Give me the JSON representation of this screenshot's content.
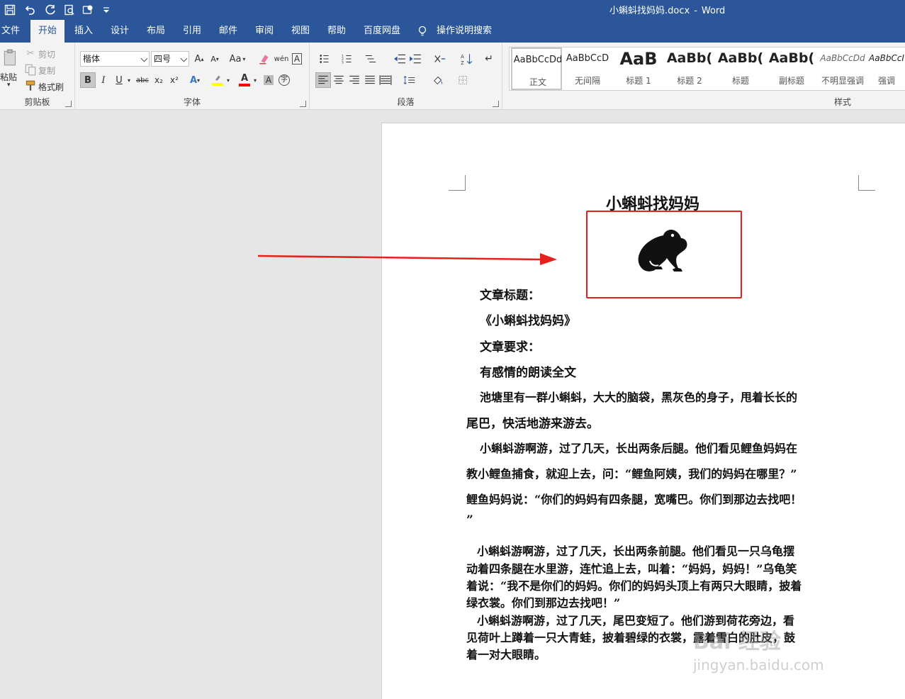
{
  "titlebar": {
    "file_name": "小蝌蚪找妈妈.docx",
    "separator": "-",
    "app_name": "Word"
  },
  "tabs": [
    {
      "label": "文件"
    },
    {
      "label": "开始"
    },
    {
      "label": "插入"
    },
    {
      "label": "设计"
    },
    {
      "label": "布局"
    },
    {
      "label": "引用"
    },
    {
      "label": "邮件"
    },
    {
      "label": "审阅"
    },
    {
      "label": "视图"
    },
    {
      "label": "帮助"
    },
    {
      "label": "百度网盘"
    }
  ],
  "tellme": {
    "label": "操作说明搜索"
  },
  "clipboard": {
    "paste": "粘贴",
    "cut": "剪切",
    "copy": "复制",
    "format_painter": "格式刷",
    "group_label": "剪贴板"
  },
  "font": {
    "family": "楷体",
    "size": "四号",
    "case_label": "Aa",
    "bold": "B",
    "italic": "I",
    "underline": "U",
    "strike": "abc",
    "subscript": "x₂",
    "superscript": "x²",
    "group_label": "字体",
    "highlight_color": "#ffff00",
    "font_color": "#ff0000"
  },
  "paragraph": {
    "group_label": "段落"
  },
  "styles": {
    "group_label": "样式",
    "items": [
      {
        "preview": "AaBbCcDd",
        "name": "正文"
      },
      {
        "preview": "AaBbCcD",
        "name": "无间隔"
      },
      {
        "preview": "AaB",
        "name": "标题 1"
      },
      {
        "preview": "AaBb(",
        "name": "标题 2"
      },
      {
        "preview": "AaBb(",
        "name": "标题"
      },
      {
        "preview": "AaBb(",
        "name": "副标题"
      },
      {
        "preview": "AaBbCcDd",
        "name": "不明显强调"
      },
      {
        "preview": "AaBbCcI",
        "name": "强调"
      }
    ]
  },
  "document": {
    "title": "小蝌蚪找妈妈",
    "lines": [
      "文章标题：",
      "《小蝌蚪找妈妈》",
      "文章要求：",
      "有感情的朗读全文",
      "池塘里有一群小蝌蚪，大大的脑袋，黑灰色的身子，甩着长长的",
      "尾巴，快活地游来游去。",
      "小蝌蚪游啊游，过了几天，长出两条后腿。他们看见鲤鱼妈妈在",
      "教小鲤鱼捕食，就迎上去，问：“鲤鱼阿姨，我们的妈妈在哪里？”",
      "鲤鱼妈妈说：“你们的妈妈有四条腿，宽嘴巴。你们到那边去找吧！",
      "”",
      "小蝌蚪游啊游，过了几天，长出两条前腿。他们看见一只乌龟摆",
      "动着四条腿在水里游，连忙追上去，叫着：“妈妈，妈妈！”乌龟笑",
      "着说：“我不是你们的妈妈。你们的妈妈头顶上有两只大眼睛，披着",
      "绿衣裳。你们到那边去找吧！”",
      "小蝌蚪游啊游，过了几天，尾巴变短了。他们游到荷花旁边，看",
      "见荷叶上蹲着一只大青蛙，披着碧绿的衣裳，露着雪白的肚皮，鼓",
      "着一对大眼睛。"
    ]
  },
  "watermark": {
    "text": "Bai 经验",
    "url_text": "jingyan.baidu.com"
  },
  "colors": {
    "brand": "#2b579a",
    "annotation_red": "#e8201d"
  }
}
